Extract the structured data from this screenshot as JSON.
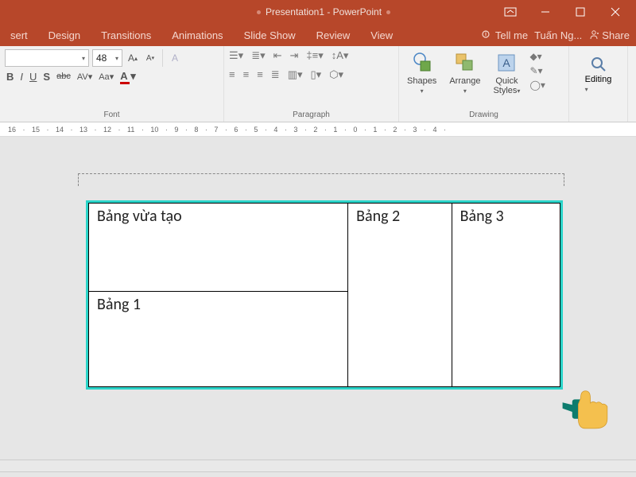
{
  "titlebar": {
    "title": "Presentation1 - PowerPoint"
  },
  "tabs": {
    "insert": "sert",
    "design": "Design",
    "transitions": "Transitions",
    "animations": "Animations",
    "slideshow": "Slide Show",
    "review": "Review",
    "view": "View",
    "tellme": "Tell me",
    "user": "Tuấn Ng...",
    "share": "Share"
  },
  "ribbon": {
    "font": {
      "label": "Font",
      "fontsize": "48",
      "bold": "B",
      "italic": "I",
      "underline": "U",
      "strike": "S",
      "strike2": "abc",
      "av": "AV",
      "aa": "Aa",
      "tri": "▾"
    },
    "paragraph": {
      "label": "Paragraph"
    },
    "drawing": {
      "label": "Drawing",
      "shapes": "Shapes",
      "arrange": "Arrange",
      "quick": "Quick",
      "styles": "Styles"
    },
    "editing": {
      "label": "",
      "editing": "Editing"
    }
  },
  "ruler_text": "16 · 15 · 14 · 13 · 12 · 11 · 10 · 9 · 8 · 7 · 6 · 5 · 4 · 3 · 2 · 1 · 0 · 1 · 2 · 3 · 4 ·",
  "table": {
    "r1c1": "Bảng vừa tạo",
    "r1c2": "Bảng 2",
    "r1c3": "Bảng 3",
    "r2c1": "Bảng 1"
  }
}
